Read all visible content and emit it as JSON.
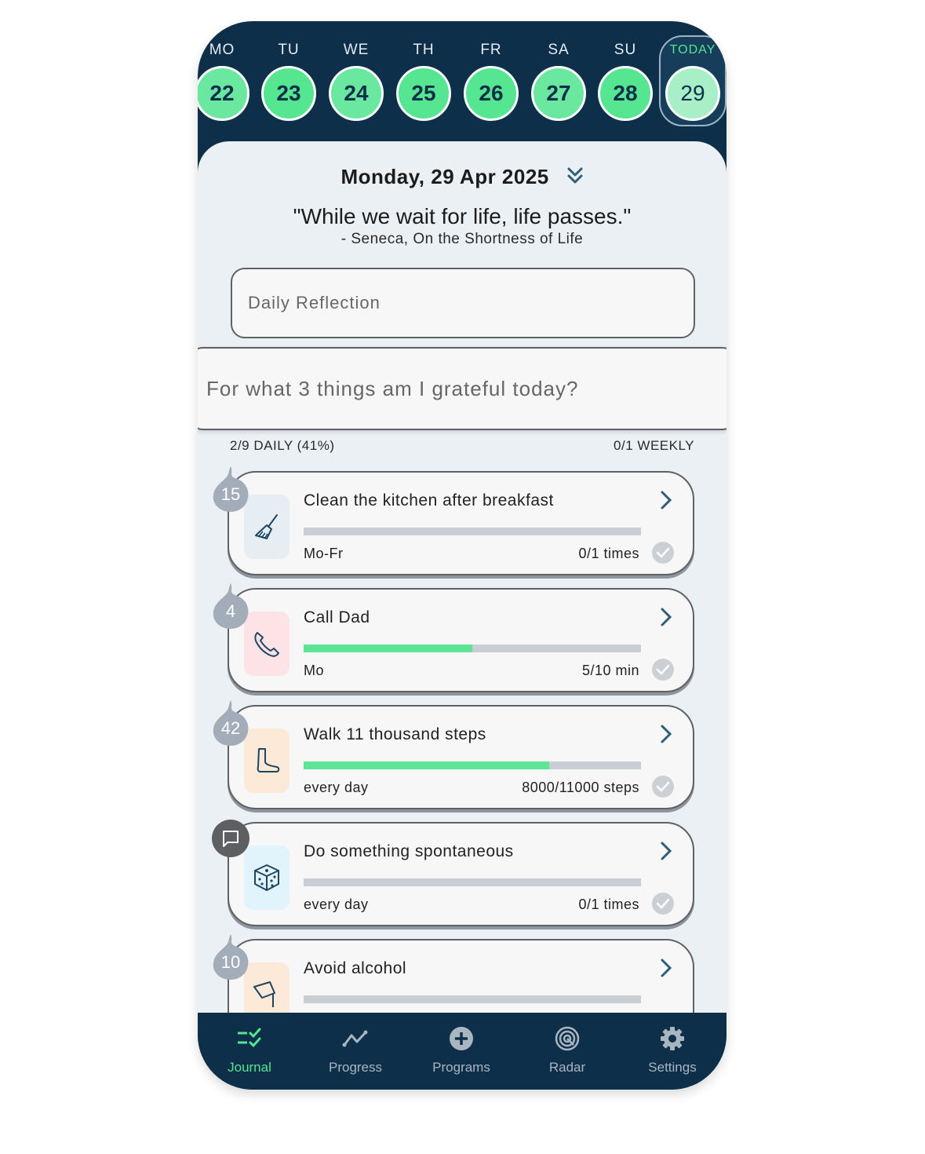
{
  "week": [
    {
      "label": "MO",
      "day": "22",
      "state": "partial"
    },
    {
      "label": "TU",
      "day": "23",
      "state": "complete"
    },
    {
      "label": "WE",
      "day": "24",
      "state": "partial"
    },
    {
      "label": "TH",
      "day": "25",
      "state": "complete"
    },
    {
      "label": "FR",
      "day": "26",
      "state": "complete"
    },
    {
      "label": "SA",
      "day": "27",
      "state": "partial"
    },
    {
      "label": "SU",
      "day": "28",
      "state": "complete"
    },
    {
      "label": "TODAY",
      "day": "29",
      "state": "today"
    }
  ],
  "header": {
    "date": "Monday, 29 Apr 2025",
    "quote": "\"While we wait for life, life passes.\"",
    "quote_source": "- Seneca, On the Shortness of Life"
  },
  "reflection": {
    "daily_placeholder": "Daily Reflection",
    "grateful_placeholder": "For what 3 things am I grateful today?"
  },
  "stats": {
    "daily": "2/9 DAILY (41%)",
    "weekly": "0/1 WEEKLY"
  },
  "habits": [
    {
      "title": "Clean the kitchen after breakfast",
      "schedule": "Mo-Fr",
      "count": "0/1 times",
      "progress": 0,
      "streak": "15",
      "icon": "broom-icon",
      "tile_color": "#e6eef4"
    },
    {
      "title": "Call Dad",
      "schedule": "Mo",
      "count": "5/10 min",
      "progress": 0.5,
      "streak": "4",
      "icon": "phone-icon",
      "tile_color": "#fde3e6"
    },
    {
      "title": "Walk 11 thousand steps",
      "schedule": "every day",
      "count": "8000/11000 steps",
      "progress": 0.727,
      "streak": "42",
      "icon": "foot-icon",
      "tile_color": "#fde9d8"
    },
    {
      "title": "Do something spontaneous",
      "schedule": "every day",
      "count": "0/1 times",
      "progress": 0,
      "streak": null,
      "icon": "dice-icon",
      "tile_color": "#e1f3fb"
    },
    {
      "title": "Avoid alcohol",
      "schedule": "",
      "count": "",
      "progress": 0,
      "streak": "10",
      "icon": "pouring-cup-icon",
      "tile_color": "#fde9d8"
    }
  ],
  "tabs": [
    {
      "label": "Journal",
      "icon": "journal-checklist-icon",
      "active": true
    },
    {
      "label": "Progress",
      "icon": "progress-chart-icon",
      "active": false
    },
    {
      "label": "Programs",
      "icon": "plus-circle-icon",
      "active": false
    },
    {
      "label": "Radar",
      "icon": "radar-icon",
      "active": false
    },
    {
      "label": "Settings",
      "icon": "gear-icon",
      "active": false
    }
  ],
  "colors": {
    "navy": "#0d2f49",
    "green": "#56e591",
    "sheet": "#ebf0f4"
  }
}
